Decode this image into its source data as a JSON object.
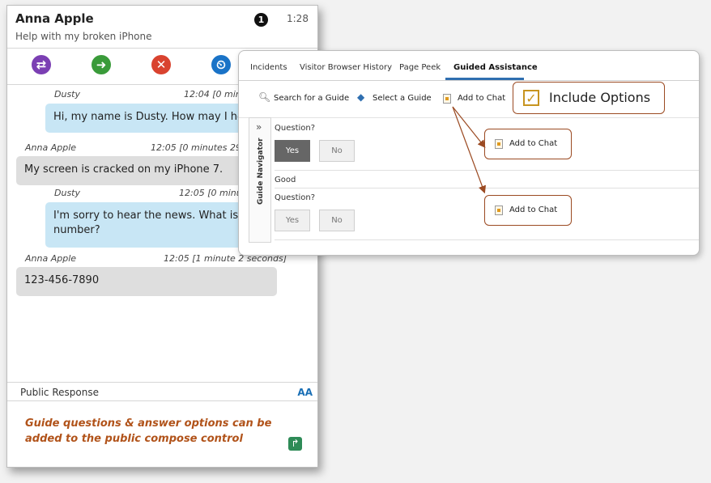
{
  "chat": {
    "customer_name": "Anna Apple",
    "subject": "Help with my broken iPhone",
    "badge_count": "1",
    "elapsed": "1:28",
    "actions": [
      {
        "icon": "transfer-icon",
        "color": "#7b3fb3",
        "glyph": "⇄"
      },
      {
        "icon": "forward-arrow-icon",
        "color": "#3a9b3a",
        "glyph": "➜"
      },
      {
        "icon": "end-chat-icon",
        "color": "#d9432f",
        "glyph": "✕"
      },
      {
        "icon": "history-clock-icon",
        "color": "#1a73c7",
        "glyph": "⏲"
      }
    ],
    "messages": [
      {
        "author": "Dusty",
        "time": "12:04 [0 minu",
        "text": "Hi, my name is Dusty. How may I help"
      },
      {
        "author": "Anna Apple",
        "time": "12:05 [0 minutes 29 s",
        "text": "My screen is cracked on my iPhone 7."
      },
      {
        "author": "Dusty",
        "time": "12:05 [0 minu",
        "text": "I'm sorry to hear the news. What is yo number?"
      },
      {
        "author": "Anna Apple",
        "time": "12:05 [1 minute 2 seconds]",
        "text": "123-456-7890"
      }
    ],
    "response_label": "Public Response",
    "font_toggle": "AA",
    "callout": "Guide questions & answer options can be added to the public compose control"
  },
  "guided": {
    "tabs": [
      "Incidents",
      "Visitor Browser History",
      "Page Peek",
      "Guided Assistance"
    ],
    "active_tab": "Guided Assistance",
    "toolbar": {
      "search": "Search for a Guide",
      "select": "Select a Guide",
      "add": "Add to Chat"
    },
    "include_options": "Include Options",
    "include_checked": true,
    "navigator_label": "Guide Navigator",
    "navigator_chevron": "»",
    "question1": {
      "label": "Question?",
      "yes": "Yes",
      "no": "No",
      "selected": "Yes"
    },
    "answer_label": "Good",
    "question2": {
      "label": "Question?",
      "yes": "Yes",
      "no": "No"
    },
    "add_chat_1": "Add to Chat",
    "add_chat_2": "Add to Chat"
  },
  "colors": {
    "callout_orange": "#b1531a",
    "callout_border": "#9b4a22",
    "agent_bubble": "#c8e6f5",
    "customer_bubble": "#dedede",
    "tab_accent": "#2f6fb0"
  }
}
